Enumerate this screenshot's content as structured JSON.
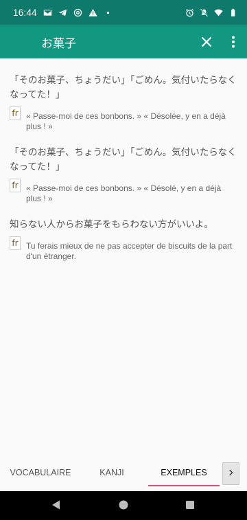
{
  "status_bar": {
    "time": "16:44",
    "left_icons": [
      "mail-icon",
      "telegram-icon",
      "at-icon",
      "warning-icon",
      "dot-icon"
    ],
    "right_icons": [
      "alarm-icon",
      "mute-icon",
      "wifi-icon",
      "battery-icon"
    ]
  },
  "app_bar": {
    "title": "お菓子",
    "close_icon": "close-icon",
    "menu_icon": "more-vert-icon",
    "colors": {
      "status": "#0d7a6c",
      "toolbar": "#129880"
    }
  },
  "examples": [
    {
      "japanese": "「そのお菓子、ちょうだい」「ごめん。気付いたらなくなってた！」",
      "lang": "fr",
      "translation": "« Passe-moi de ces bonbons. » « Désolée, y en a déjà plus ! »"
    },
    {
      "japanese": "「そのお菓子、ちょうだい」「ごめん。気付いたらなくなってた！」",
      "lang": "fr",
      "translation": "« Passe-moi de ces bonbons. » « Désolé, y en a déjà plus ! »"
    },
    {
      "japanese": "知らない人からお菓子をもらわない方がいいよ。",
      "lang": "fr",
      "translation": "Tu ferais mieux de ne pas accepter de biscuits de la part d'un étranger."
    }
  ],
  "tabs": {
    "items": [
      "VOCABULAIRE",
      "KANJI",
      "EXEMPLES"
    ],
    "active": "EXEMPLES",
    "indicator_color": "#e24e72"
  },
  "nav_bar": {
    "buttons": [
      "back-icon",
      "home-icon",
      "recents-icon"
    ]
  }
}
